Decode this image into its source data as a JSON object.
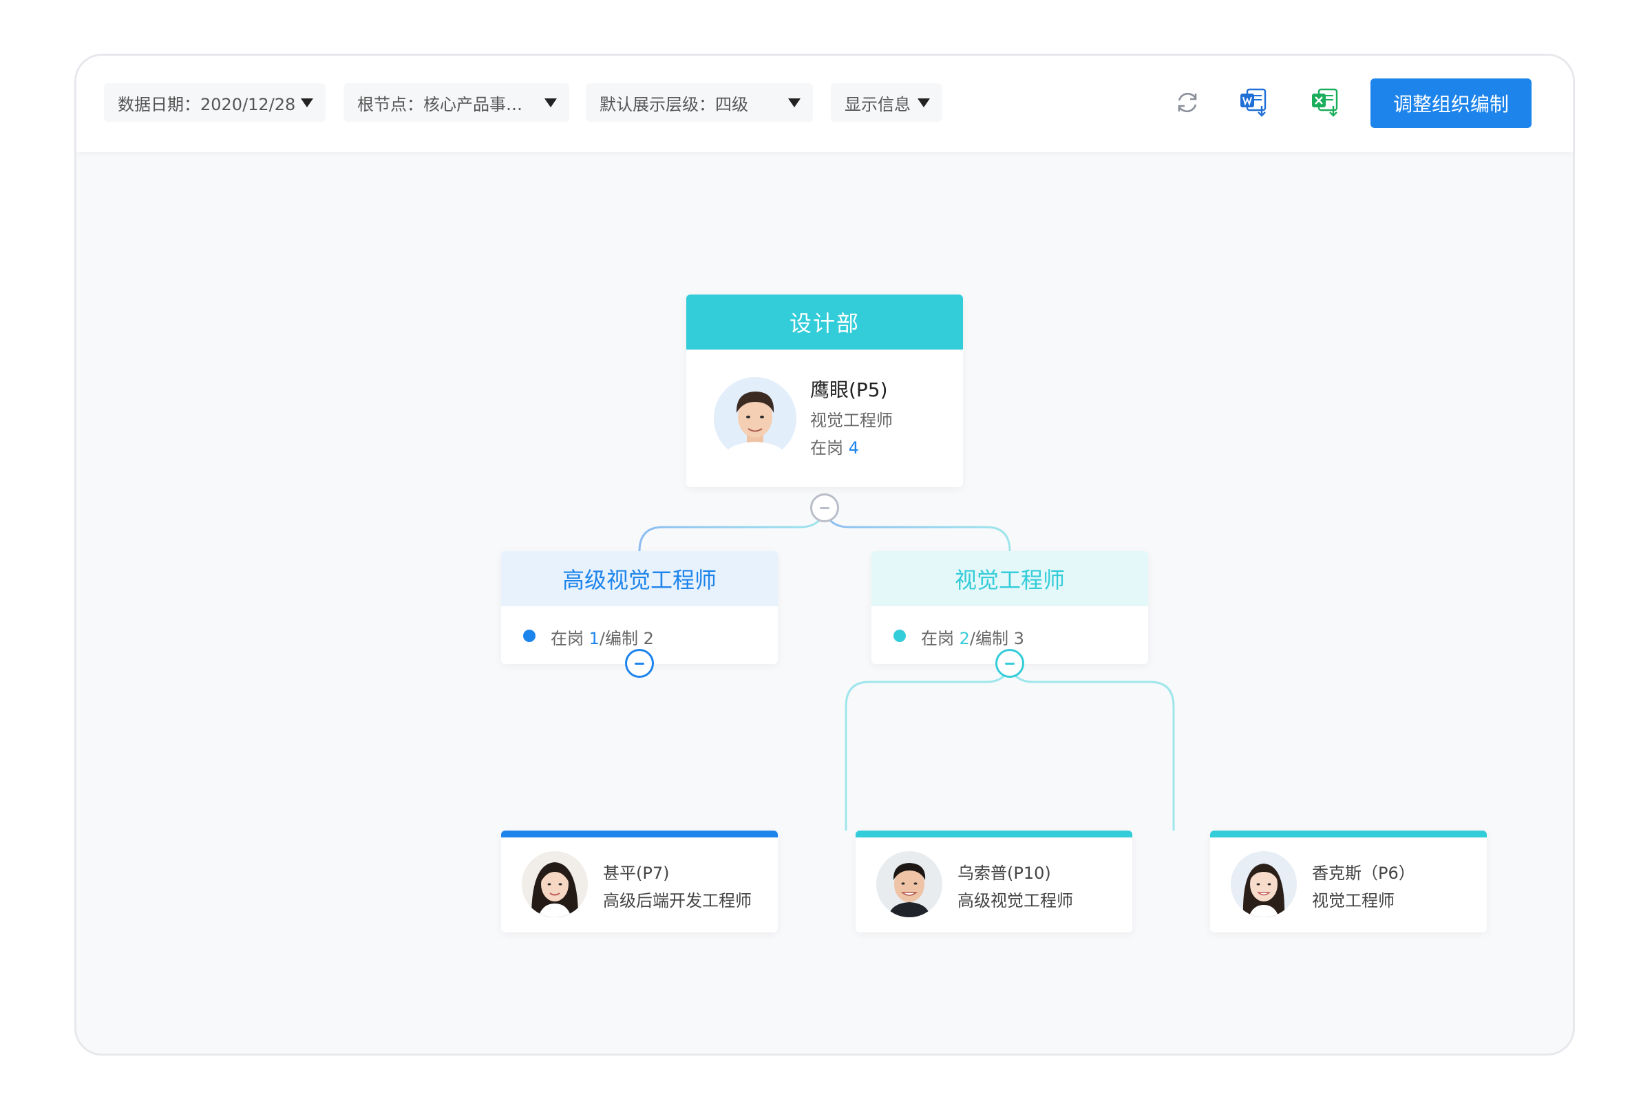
{
  "toolbar": {
    "filters": [
      {
        "label": "数据日期：2020/12/28"
      },
      {
        "label": "根节点：核心产品事…"
      },
      {
        "label": "默认展示层级：四级"
      },
      {
        "label": "显示信息"
      }
    ],
    "icons": [
      "refresh-icon",
      "export-word-icon",
      "export-excel-icon"
    ],
    "primary_button": "调整组织编制"
  },
  "colors": {
    "primary": "#1d84ec",
    "cyan": "#33ccd9",
    "word": "#1f6fd6",
    "excel": "#1aad5c"
  },
  "org": {
    "root": {
      "department": "设计部",
      "name": "鹰眼(P5)",
      "title": "视觉工程师",
      "stat_label": "在岗",
      "stat_value": "4"
    },
    "positions": [
      {
        "title": "高级视觉工程师",
        "stat_label": "在岗",
        "current": "1",
        "quota": "/编制 2"
      },
      {
        "title": "视觉工程师",
        "stat_label": "在岗",
        "current": "2",
        "quota": "/编制 3"
      }
    ],
    "people": [
      {
        "name": "甚平(P7)",
        "title": "高级后端开发工程师"
      },
      {
        "name": "乌索普(P10)",
        "title": "高级视觉工程师"
      },
      {
        "name": "香克斯（P6）",
        "title": "视觉工程师"
      }
    ]
  }
}
